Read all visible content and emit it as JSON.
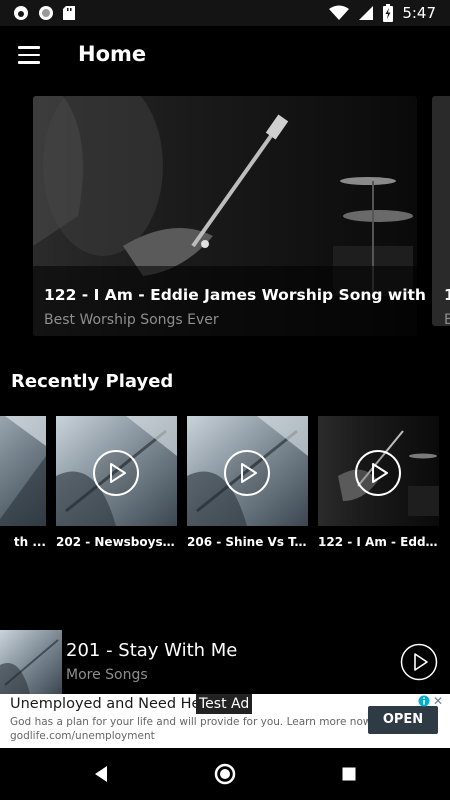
{
  "status_bar": {
    "time": "5:47",
    "icons": [
      "app-notification-icon",
      "record-icon",
      "sd-card-icon",
      "wifi-icon",
      "signal-icon",
      "battery-charging-icon"
    ]
  },
  "app_bar": {
    "title": "Home",
    "menu_icon": "hamburger-menu-icon"
  },
  "featured": [
    {
      "title": "122 - I Am - Eddie James Worship Song with",
      "subtitle": "Best Worship Songs Ever"
    },
    {
      "title": "1",
      "subtitle": "B"
    }
  ],
  "recently_played": {
    "heading": "Recently Played",
    "items": [
      {
        "label": "th ..."
      },
      {
        "label": "202 - Newsboys ..."
      },
      {
        "label": "206 - Shine Vs T..."
      },
      {
        "label": "122 - I Am - Edd..."
      }
    ]
  },
  "mini_player": {
    "title": "201 - Stay With Me",
    "subtitle": "More Songs",
    "play_icon": "play-circle-icon"
  },
  "ad": {
    "headline": "Unemployed and Need Help",
    "tag": "Test Ad",
    "body": "God has a plan for your life and will provide for you. Learn more now.",
    "url": "godlife.com/unemployment",
    "cta": "OPEN",
    "info_icon": "info-icon",
    "close_icon": "close-icon"
  },
  "nav_bar": {
    "icons": [
      "back-icon",
      "home-icon",
      "recents-icon"
    ]
  },
  "colors": {
    "background": "#000000",
    "status_bar": "#141414",
    "secondary_text": "#8e8e8e",
    "ad_button": "#2e3b44"
  }
}
